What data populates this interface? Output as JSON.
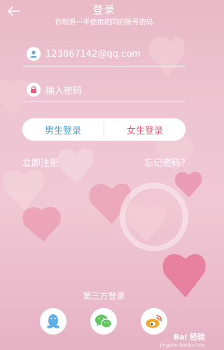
{
  "header": {
    "title": "登录",
    "subtitle": "你和另一半使用相同的账号密码"
  },
  "form": {
    "account_value": "123867142@qq.com",
    "password_placeholder": "输入密码"
  },
  "buttons": {
    "male_login": "男生登录",
    "female_login": "女生登录"
  },
  "links": {
    "register": "立即注册",
    "forgot_password": "忘记密码?"
  },
  "third_party": {
    "title": "第三方登录",
    "providers": [
      "qq-icon",
      "wechat-icon",
      "weibo-icon"
    ]
  },
  "watermark": {
    "main": "Bai 经验",
    "sub": "jingyan.baidu.com"
  },
  "colors": {
    "male_accent": "#4ba3d6",
    "female_accent": "#e8607d",
    "qq": "#5fb0e8",
    "wechat": "#5ec65c",
    "weibo": "#f0a82a"
  }
}
